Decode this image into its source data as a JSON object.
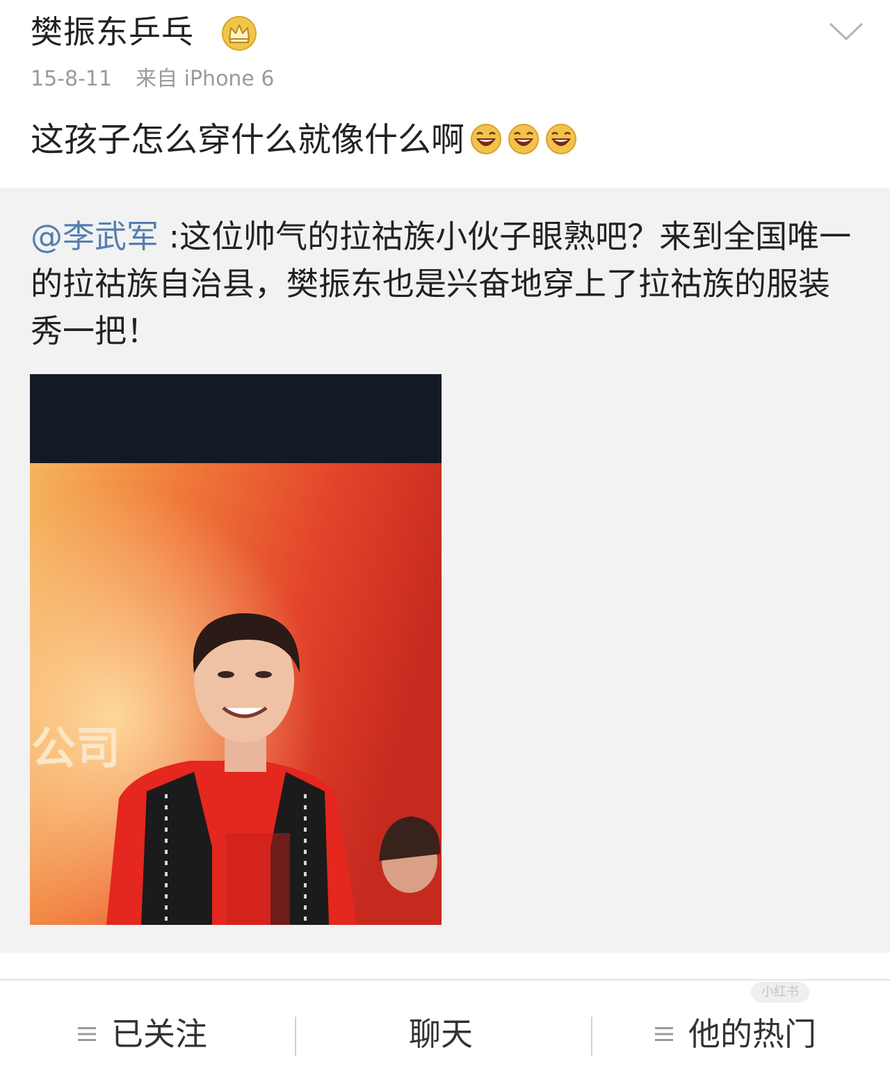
{
  "post": {
    "username": "樊振东乒乓",
    "time": "15-8-11",
    "source": "来自 iPhone 6",
    "text": "这孩子怎么穿什么就像什么啊",
    "emoji_count": 3
  },
  "repost": {
    "mention": "@李武军",
    "text": " :这位帅气的拉祜族小伙子眼熟吧？来到全国唯一的拉祜族自治县，樊振东也是兴奋地穿上了拉祜族的服装秀一把！",
    "photo_caption_text": "公司"
  },
  "toolbar": {
    "follow_label": "已关注",
    "chat_label": "聊天",
    "hot_label": "他的热门"
  },
  "watermark": "小红书",
  "colors": {
    "mention": "#557fb0",
    "background": "#ffffff",
    "repost_background": "#f2f2f2",
    "meta_text": "#9a9a9a"
  },
  "icons": [
    "vip-crown-icon",
    "chevron-down-icon",
    "laugh-emoji-icon",
    "menu-icon"
  ]
}
